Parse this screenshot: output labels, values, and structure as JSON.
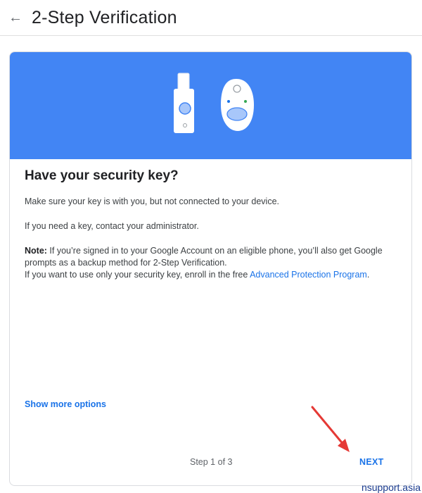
{
  "header": {
    "back_icon": "arrow-left-icon",
    "title": "2-Step Verification"
  },
  "hero": {
    "background": "#4285f4",
    "icons": [
      "usb-security-key-icon",
      "bluetooth-security-key-icon"
    ]
  },
  "main": {
    "heading": "Have your security key?",
    "para1": "Make sure your key is with you, but not connected to your device.",
    "para2": "If you need a key, contact your administrator.",
    "note_label": "Note:",
    "note_line1": " If you’re signed in to your Google Account on an eligible phone, you’ll also get Google",
    "note_line2": "prompts as a backup method for 2-Step Verification.",
    "note_line3_prefix": "If you want to use only your security key, enroll in the free ",
    "note_link": "Advanced Protection Program",
    "note_line3_suffix": "."
  },
  "footer": {
    "show_more": "Show more options",
    "step": "Step 1 of 3",
    "next": "NEXT"
  },
  "watermark": "nsupport.asia",
  "colors": {
    "accent": "#1a73e8",
    "hero": "#4285f4",
    "annotation_arrow": "#e53935"
  }
}
